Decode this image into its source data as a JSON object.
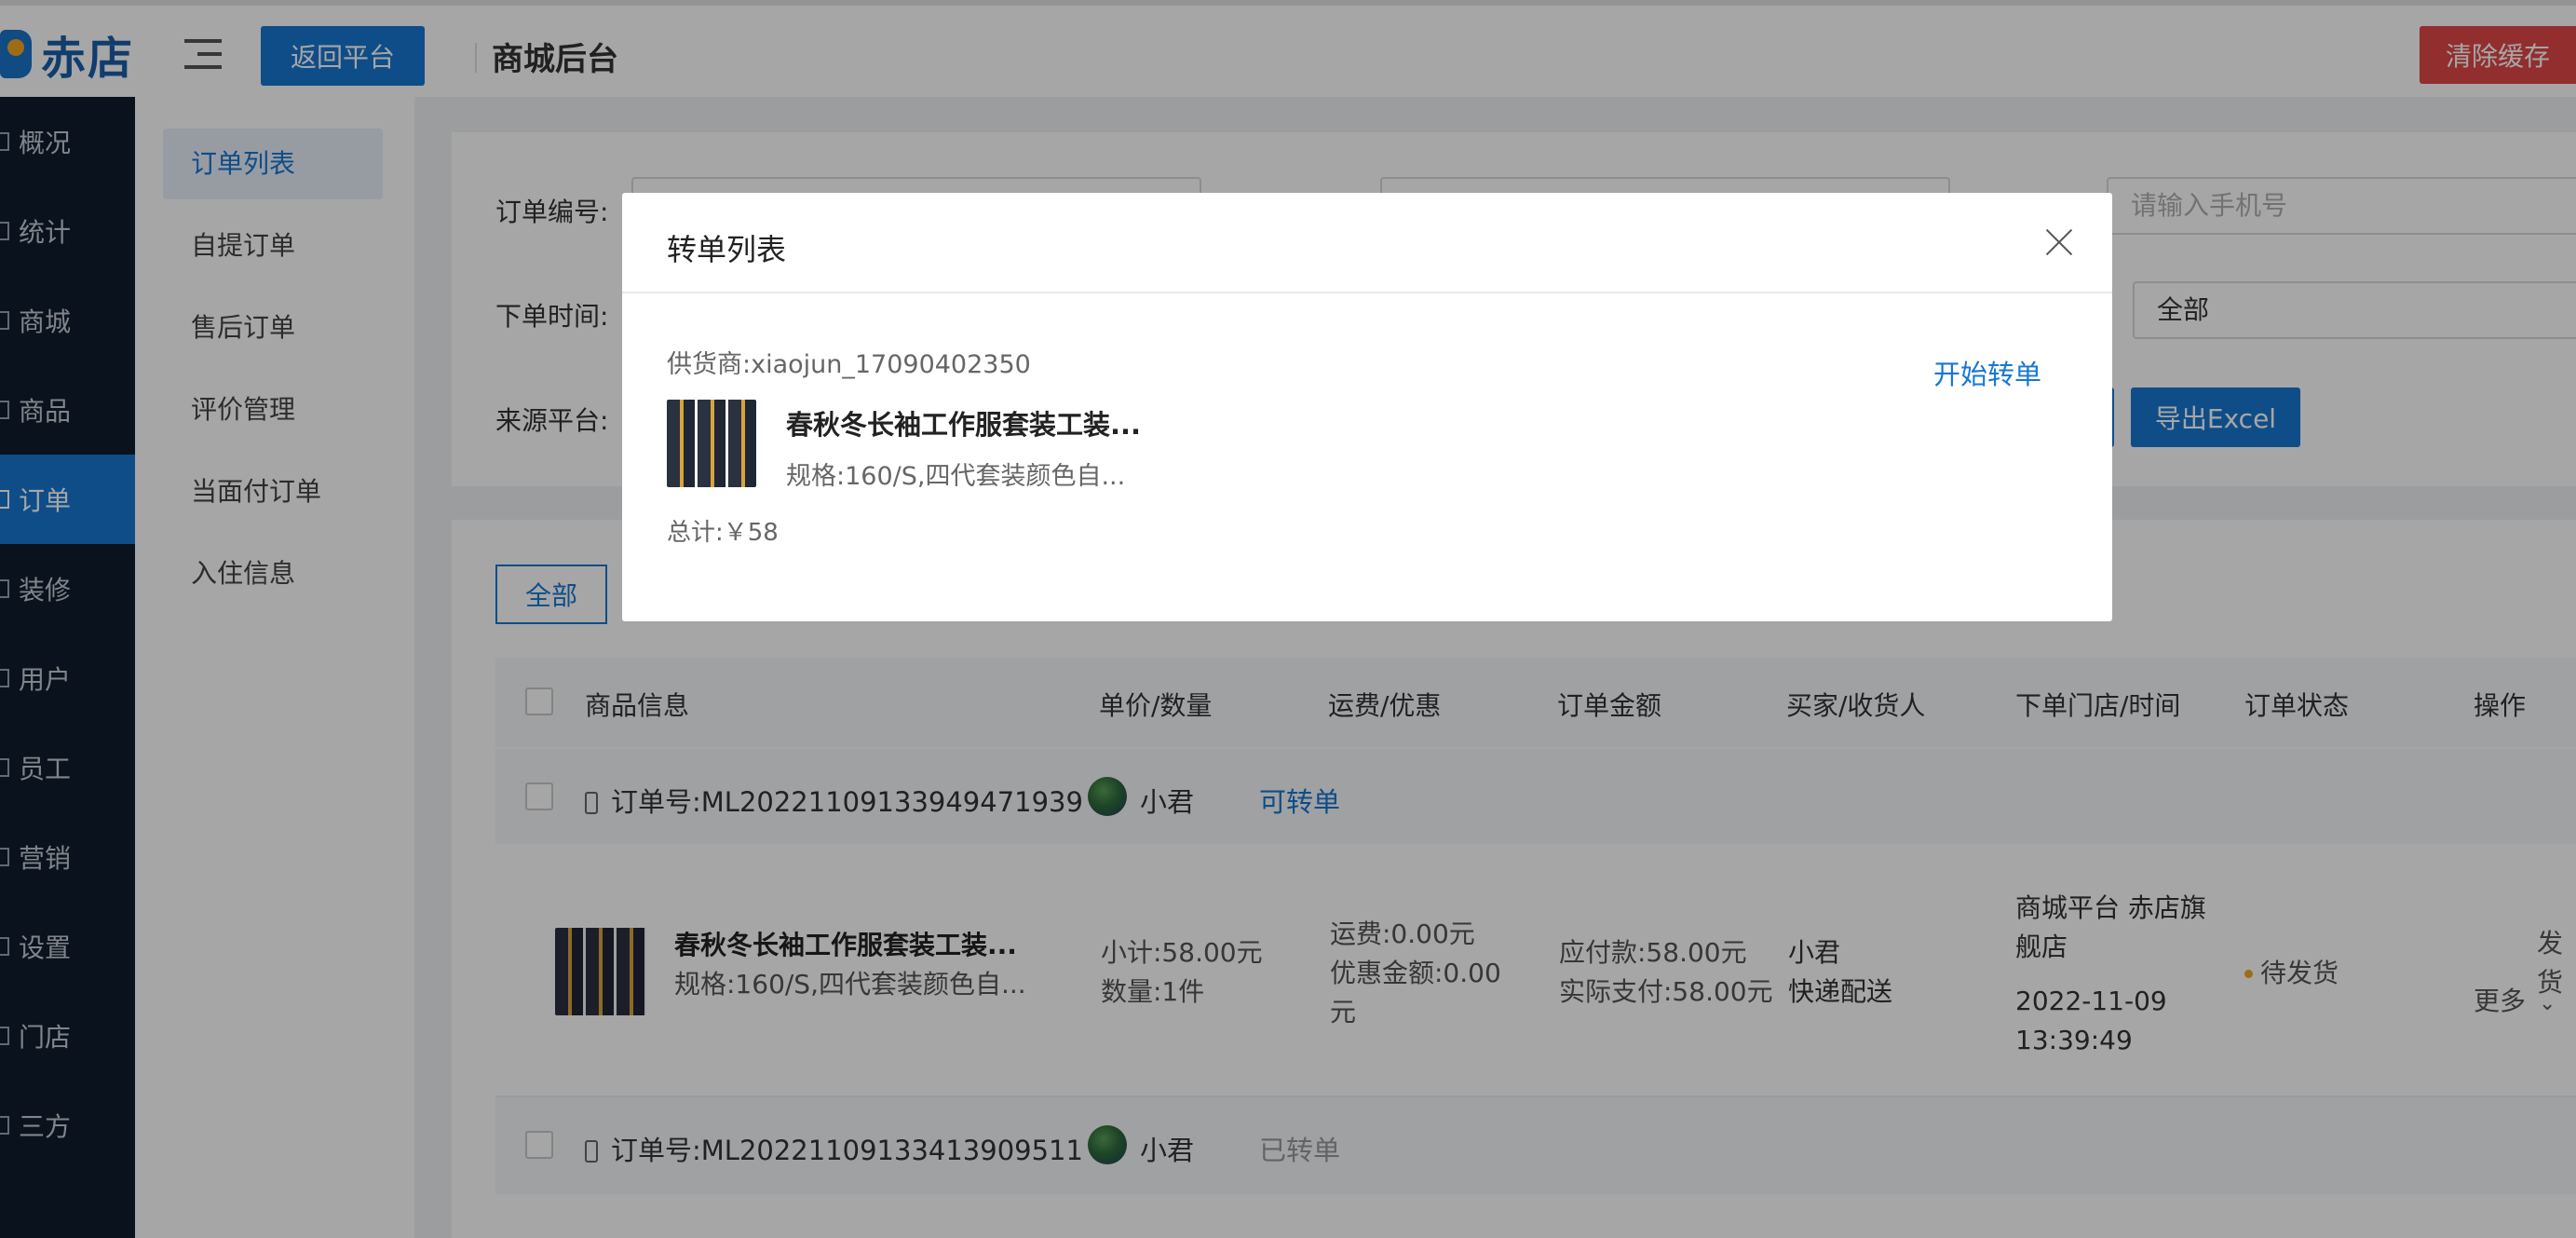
{
  "header": {
    "logo_text": "赤店",
    "back_button": "返回平台",
    "title": "商城后台",
    "clear_cache_button": "清除缓存"
  },
  "sidebar": {
    "items": [
      {
        "label": "概况",
        "icon": "dashboard-icon"
      },
      {
        "label": "统计",
        "icon": "chart-icon"
      },
      {
        "label": "商城",
        "icon": "store-icon"
      },
      {
        "label": "商品",
        "icon": "goods-icon"
      },
      {
        "label": "订单",
        "icon": "order-icon",
        "active": true
      },
      {
        "label": "装修",
        "icon": "decoration-icon"
      },
      {
        "label": "用户",
        "icon": "user-icon"
      },
      {
        "label": "员工",
        "icon": "staff-icon"
      },
      {
        "label": "营销",
        "icon": "marketing-icon"
      },
      {
        "label": "设置",
        "icon": "settings-icon"
      },
      {
        "label": "门店",
        "icon": "shop-icon"
      },
      {
        "label": "三方",
        "icon": "third-party-icon"
      }
    ]
  },
  "subnav": {
    "items": [
      "订单列表",
      "自提订单",
      "售后订单",
      "评价管理",
      "当面付订单",
      "入住信息"
    ],
    "active": "订单列表"
  },
  "filters": {
    "order_no_label": "订单编号:",
    "order_time_label": "下单时间:",
    "source_label": "来源平台:",
    "phone_placeholder": "请输入手机号",
    "status_select": "全部",
    "export_button": "导出Excel"
  },
  "tabs": {
    "all": "全部"
  },
  "table": {
    "headers": [
      "商品信息",
      "单价/数量",
      "运费/优惠",
      "订单金额",
      "买家/收货人",
      "下单门店/时间",
      "订单状态",
      "操作"
    ],
    "orders": [
      {
        "order_label": "订单号:ML20221109133949471939",
        "buyer": "小君",
        "transfer_status": "可转单",
        "product_name": "春秋冬长袖工作服套装工装...",
        "product_spec": "规格:160/S,四代套装颜色自...",
        "subtotal": "小计:58.00元",
        "quantity": "数量:1件",
        "shipping": "运费:0.00元",
        "discount": "优惠金额:0.00",
        "discount_unit": "元",
        "payable": "应付款:58.00元",
        "paid": "实际支付:58.00元",
        "receiver": "小君",
        "delivery": "快递配送",
        "store": "商城平台 赤店旗",
        "store2": "舰店",
        "date": "2022-11-09",
        "time": "13:39:49",
        "status": "待发货",
        "action_ship": "发货",
        "action_more": "更多"
      },
      {
        "order_label": "订单号:ML20221109133413909511",
        "buyer": "小君",
        "transfer_status": "已转单"
      }
    ]
  },
  "modal": {
    "title": "转单列表",
    "supplier": "供货商:xiaojun_17090402350",
    "start_button": "开始转单",
    "product_name": "春秋冬长袖工作服套装工装...",
    "product_spec": "规格:160/S,四代套装颜色自...",
    "total": "总计:￥58"
  }
}
